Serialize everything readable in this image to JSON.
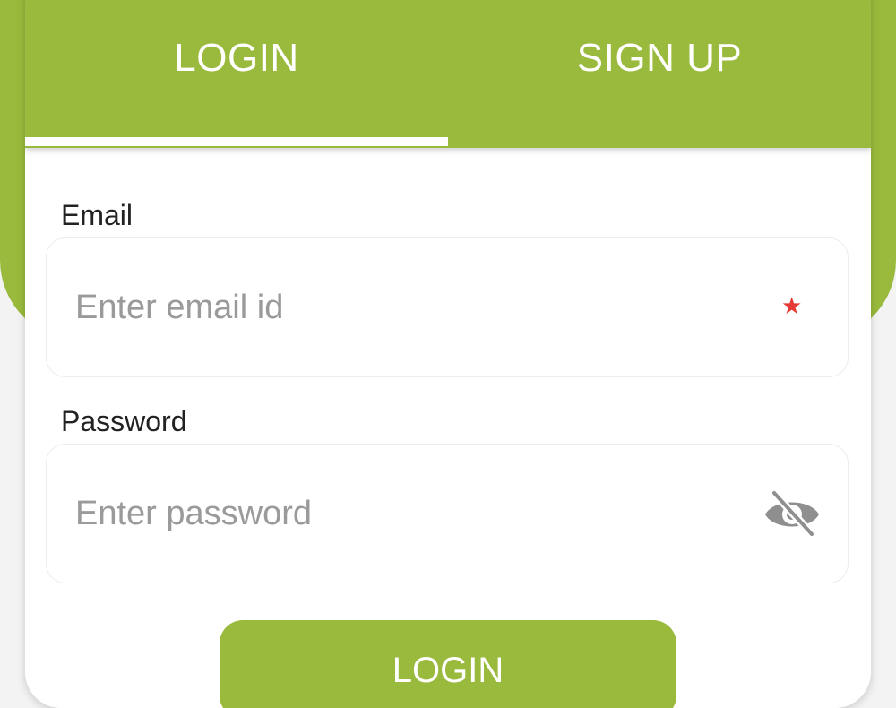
{
  "tabs": {
    "login_label": "LOGIN",
    "signup_label": "SIGN UP",
    "active": "login"
  },
  "form": {
    "email_label": "Email",
    "email_placeholder": "Enter email id",
    "email_value": "",
    "email_required_marker": "★",
    "password_label": "Password",
    "password_placeholder": "Enter password",
    "password_value": "",
    "password_toggle_icon": "eye-off-icon"
  },
  "actions": {
    "login_button_label": "LOGIN"
  },
  "colors": {
    "brand_green": "#9aba3d",
    "required_red": "#e53935",
    "placeholder_gray": "#9a9a9a"
  }
}
